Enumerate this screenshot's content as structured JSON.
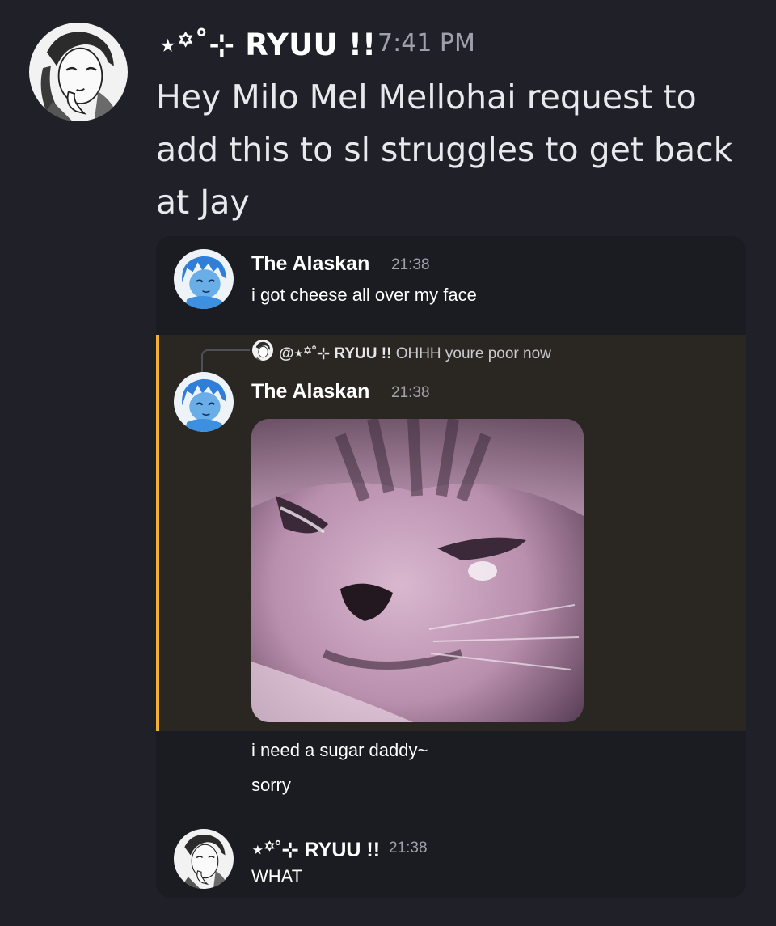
{
  "outer_message": {
    "author": "⋆꙳˚⊹ RYUU !!",
    "timestamp": "7:41 PM",
    "text": "Hey Milo Mel Mellohai request to add this to sl struggles to get back at Jay"
  },
  "embedded_chat": {
    "messages": [
      {
        "author": "The Alaskan",
        "timestamp": "21:38",
        "text": "i got cheese all over my face"
      },
      {
        "reply_to": {
          "mention": "@⋆꙳˚⊹ RYUU !!",
          "text": "OHHH youre poor now"
        },
        "author": "The Alaskan",
        "timestamp": "21:38",
        "attachment": "crying-cat-image",
        "followups": [
          "i need a sugar daddy~",
          "sorry"
        ]
      },
      {
        "author": "⋆꙳˚⊹ RYUU !!",
        "timestamp": "21:38",
        "text": "WHAT"
      }
    ]
  },
  "colors": {
    "background": "#1f2028",
    "embed_background": "#1b1c22",
    "highlight_background": "#2a2723",
    "highlight_border": "#f0b232",
    "timestamp": "#9ea1ab"
  }
}
